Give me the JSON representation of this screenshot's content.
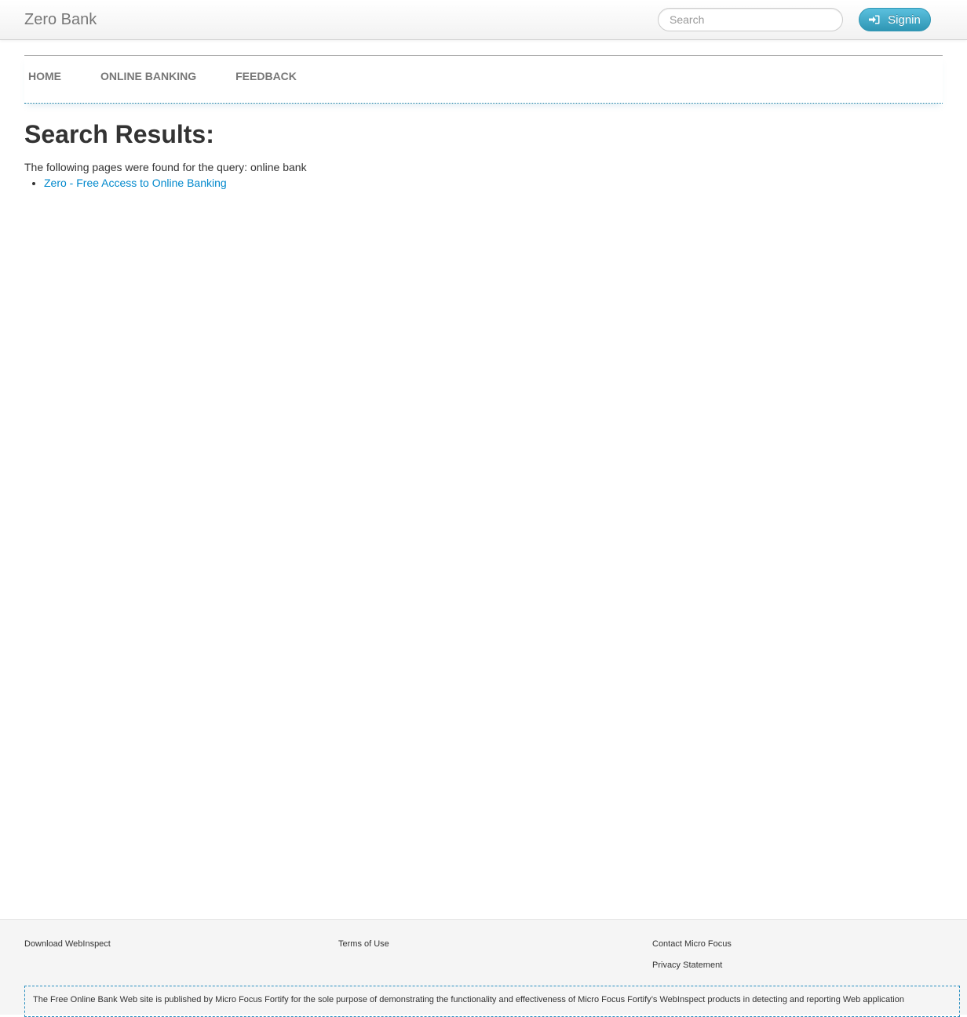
{
  "header": {
    "brand": "Zero Bank",
    "search_placeholder": "Search",
    "search_value": "",
    "signin_label": "Signin",
    "signin_icon": "signin-arrow-icon",
    "accent_color": "#2f96b4"
  },
  "nav": {
    "items": [
      {
        "label": "HOME"
      },
      {
        "label": "ONLINE BANKING"
      },
      {
        "label": "FEEDBACK"
      }
    ]
  },
  "main": {
    "title": "Search Results:",
    "query_text": "The following pages were found for the query: online bank",
    "results": [
      {
        "label": "Zero - Free Access to Online Banking"
      }
    ],
    "link_color": "#0088cc"
  },
  "footer": {
    "col1": [
      "Download WebInspect"
    ],
    "col2": [
      "Terms of Use"
    ],
    "col3": [
      "Contact Micro Focus",
      "Privacy Statement"
    ],
    "disclaimer": "The Free Online Bank Web site is published by Micro Focus Fortify for the sole purpose of demonstrating the functionality and effectiveness of Micro Focus Fortify’s WebInspect products in detecting and reporting Web application"
  }
}
